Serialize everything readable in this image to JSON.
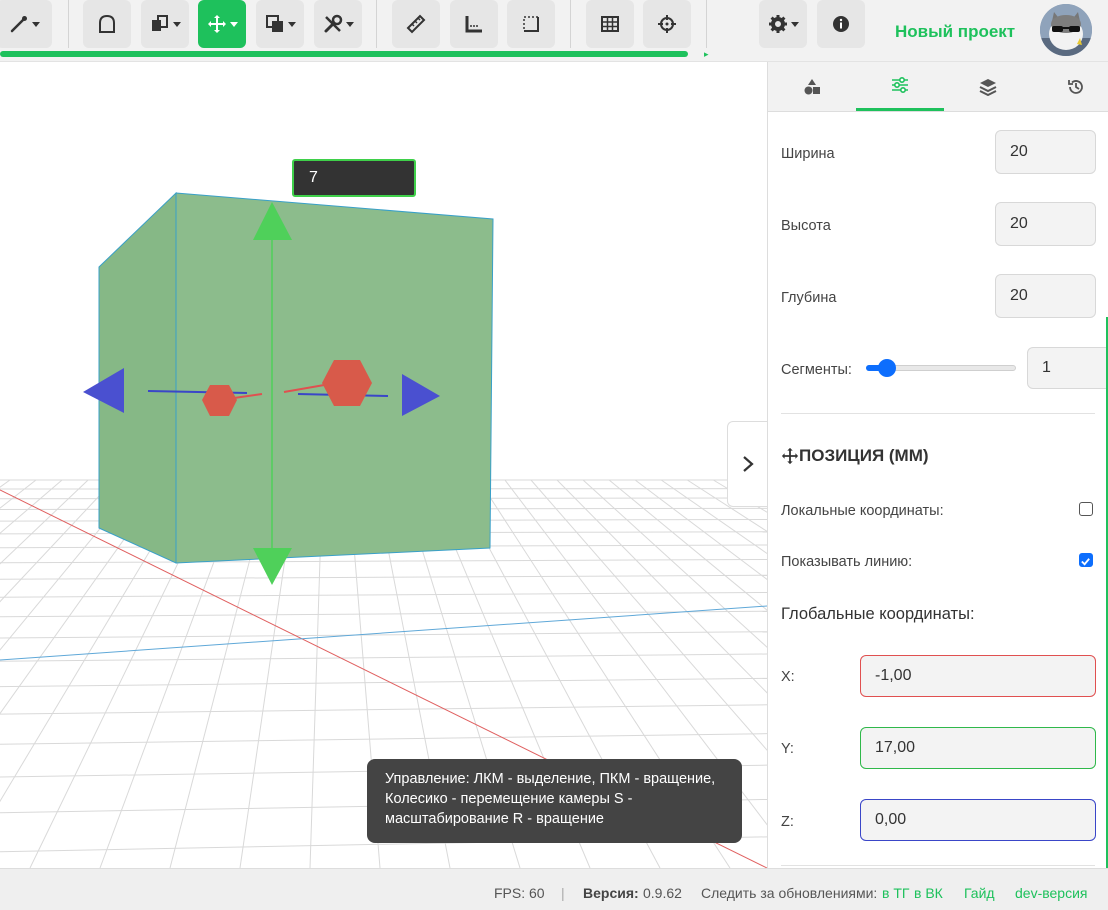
{
  "toolbar": {
    "buttons": [
      "draw-tool",
      "shape-tool",
      "object-tool",
      "move-tool",
      "boolean-tool",
      "modify-tool",
      "ruler-tool",
      "measure-tool",
      "frame-tool",
      "grid-tool",
      "snap-tool",
      "settings-tool",
      "info-tool"
    ],
    "active": "move-tool",
    "progress": 1.0
  },
  "header": {
    "project_title": "Новый проект"
  },
  "viewport": {
    "dimension_value": "7",
    "help_text": "Управление: ЛКМ - выделение, ПКМ - вращение, Колесико - перемещение камеры S - масштабирование R - вращение"
  },
  "panel": {
    "tabs": [
      "shapes-icon",
      "sliders-icon",
      "layers-icon",
      "history-icon"
    ],
    "active_tab": 1,
    "width_label": "Ширина",
    "width_value": "20",
    "height_label": "Высота",
    "height_value": "20",
    "depth_label": "Глубина",
    "depth_value": "20",
    "segments_label": "Сегменты:",
    "segments_value": "1",
    "position_title": "ПОЗИЦИЯ (ММ)",
    "local_coords_label": "Локальные координаты:",
    "local_coords_checked": false,
    "show_line_label": "Показывать линию:",
    "show_line_checked": true,
    "global_coords_title": "Глобальные координаты:",
    "x_label": "X:",
    "x_value": "-1,00",
    "y_label": "Y:",
    "y_value": "17,00",
    "z_label": "Z:",
    "z_value": "0,00"
  },
  "status": {
    "fps": "FPS: 60",
    "separator": "|",
    "version_label": "Версия:",
    "version_value": "0.9.62",
    "follow_label": "Следить за обновлениями:",
    "tg_link": "в ТГ",
    "vk_link": "в ВК",
    "guide_link": "Гайд",
    "dev_link": "dev-версия"
  },
  "colors": {
    "accent": "#1ec15c",
    "x_axis": "#e05050",
    "y_axis": "#2fb84a",
    "z_axis": "#3a46c8",
    "cube_fill": "#8dbb8d"
  }
}
